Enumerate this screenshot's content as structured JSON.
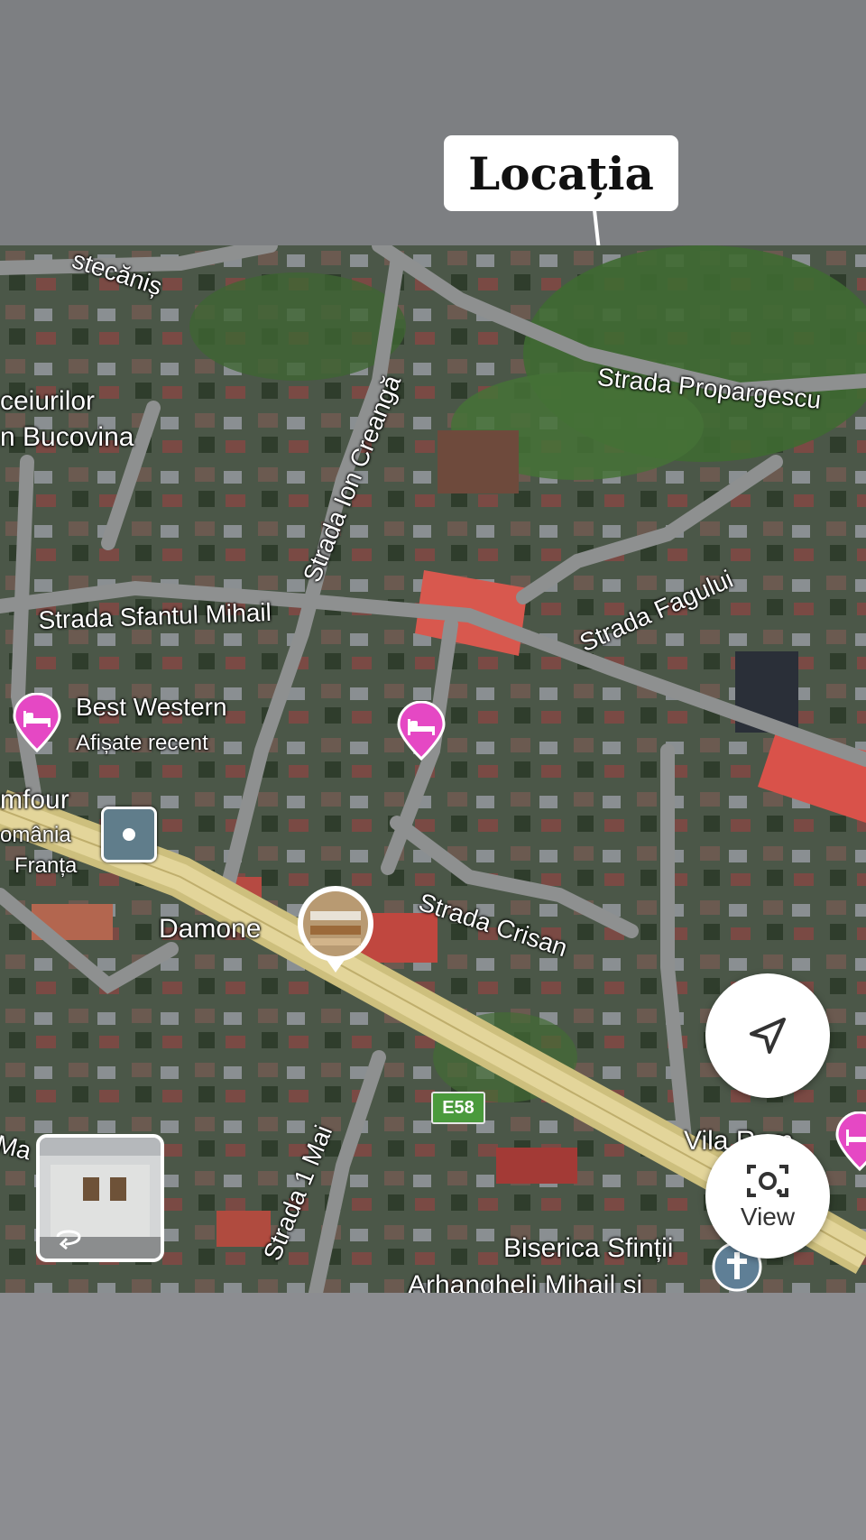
{
  "callout": {
    "label": "Locația"
  },
  "streets": [
    {
      "id": "strada-ion-creanga",
      "name": "Strada Ion Creangă"
    },
    {
      "id": "strada-propargescu",
      "name": "Strada Propargescu"
    },
    {
      "id": "strada-fagului",
      "name": "Strada Fagului"
    },
    {
      "id": "strada-sfantul-mihail",
      "name": "Strada Sfantul Mihail"
    },
    {
      "id": "strada-crisan",
      "name": "Strada Crisan"
    },
    {
      "id": "strada-1-mai",
      "name": "Strada 1 Mai"
    },
    {
      "id": "stecanis-fragment",
      "name": "stecăniș"
    },
    {
      "id": "ma-fragment",
      "name": "Ma"
    }
  ],
  "places": {
    "best_western": {
      "name": "Best Western",
      "subtitle": "Afișate recent"
    },
    "damone": {
      "name": "Damone"
    },
    "vila": {
      "name": "Vila Rom"
    },
    "biserica": {
      "line1": "Biserica Sfinții",
      "line2": "Arhangheli Mihail și"
    },
    "ceiurilor": {
      "line1": "ceiurilor",
      "line2": "n Bucovina"
    },
    "mfour": {
      "line1": "mfour",
      "line2": "omânia",
      "line3": "Franța"
    }
  },
  "road_shield": {
    "label": "E58",
    "color": "#4a9a3c"
  },
  "controls": {
    "locate_icon": "navigation-arrow-icon",
    "view_icon": "camera-lens-icon",
    "view_label": "View",
    "streetview_icon": "rotate-360-icon"
  },
  "colors": {
    "hotel_pin": "#e548c4",
    "church_pin": "#5f7f96",
    "road": "#8e9090",
    "highway": "#d8c986"
  }
}
